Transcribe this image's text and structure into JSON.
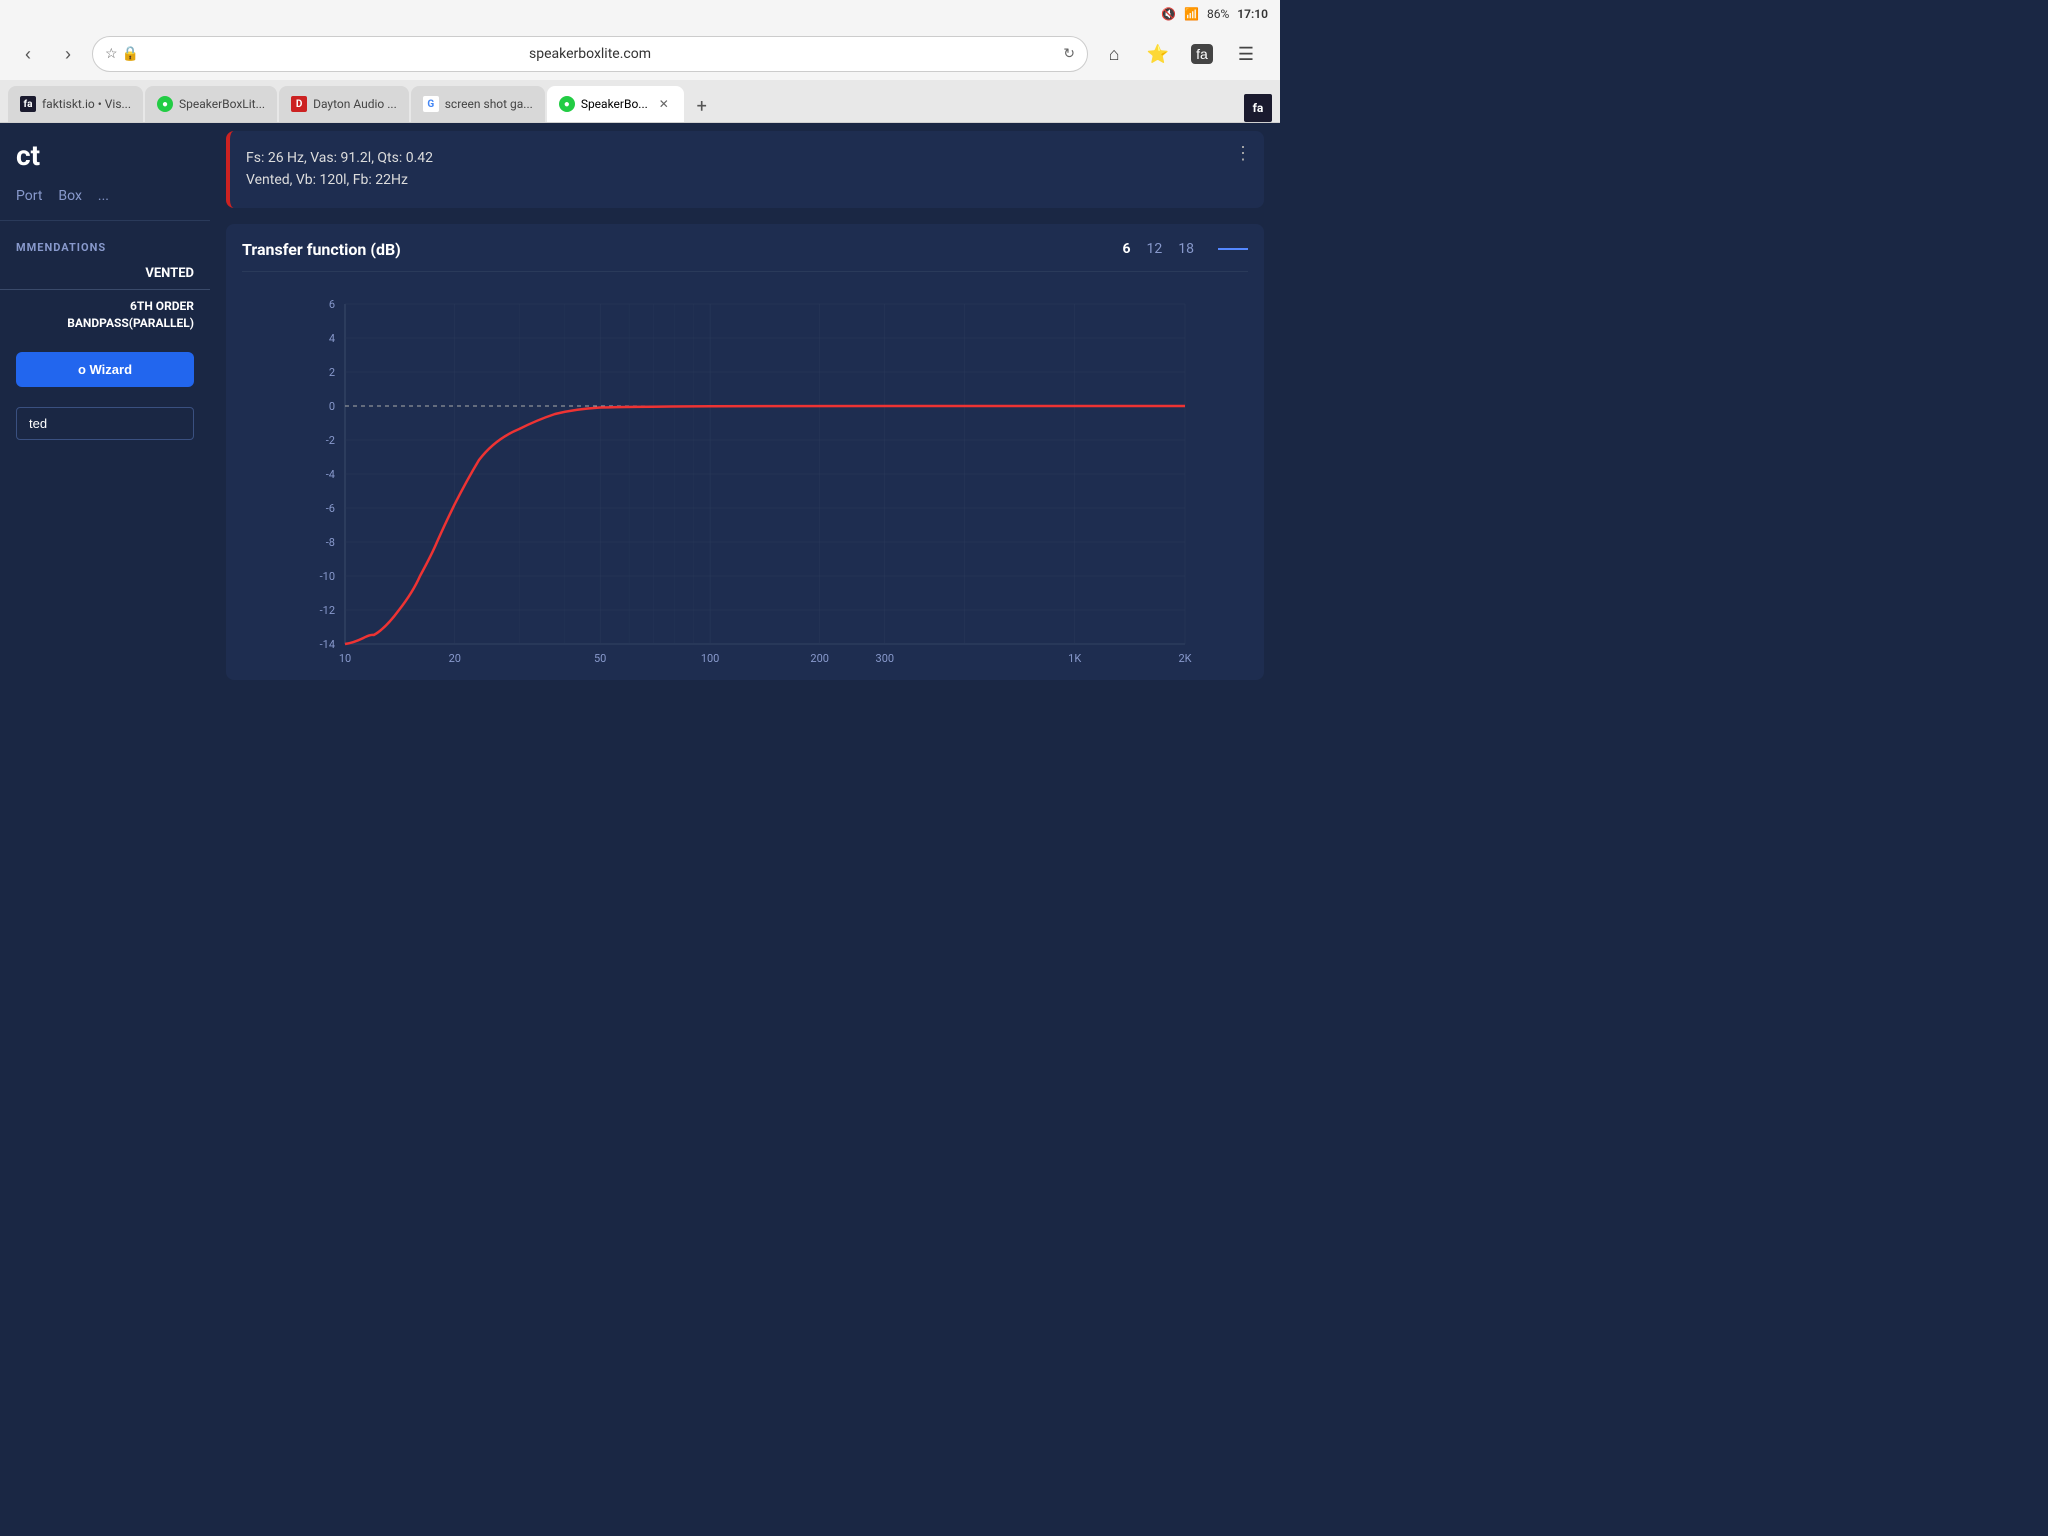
{
  "status_bar": {
    "battery": "86%",
    "time": "17:10"
  },
  "browser": {
    "back_label": "‹",
    "forward_label": "›",
    "url": "speakerboxlite.com",
    "tabs": [
      {
        "id": "tab1",
        "favicon_type": "fa",
        "favicon_text": "fa",
        "label": "faktiskt.io • Vis...",
        "active": false,
        "closeable": false
      },
      {
        "id": "tab2",
        "favicon_type": "spk",
        "favicon_text": "●",
        "label": "SpeakerBoxLit...",
        "active": false,
        "closeable": false
      },
      {
        "id": "tab3",
        "favicon_type": "dayton",
        "favicon_text": "D",
        "label": "Dayton Audio ...",
        "active": false,
        "closeable": false
      },
      {
        "id": "tab4",
        "favicon_type": "google",
        "favicon_text": "G",
        "label": "screen shot ga...",
        "active": false,
        "closeable": false
      },
      {
        "id": "tab5",
        "favicon_type": "spk",
        "favicon_text": "●",
        "label": "SpeakerBo...",
        "active": true,
        "closeable": true
      }
    ],
    "new_tab_label": "+"
  },
  "sidebar": {
    "title_partial": "ct",
    "tabs": [
      {
        "label": "Port",
        "active": false
      },
      {
        "label": "Box",
        "active": false
      },
      {
        "label": "...",
        "active": false
      }
    ],
    "section_title": "MMENDATIONS",
    "vented_label": "VENTED",
    "bandpass_label": "6TH ORDER\nBANDPASS(PARALLEL)",
    "wizard_btn_label": "o Wizard",
    "input_placeholder": "ted"
  },
  "info_card": {
    "line1": "Fs: 26 Hz, Vas: 91.2l, Qts: 0.42",
    "line2": "Vented, Vb: 120l, Fb: 22Hz"
  },
  "chart": {
    "title": "Transfer function (dB)",
    "range_options": [
      "6",
      "12",
      "18"
    ],
    "active_range": "6",
    "y_labels": [
      "6",
      "4",
      "2",
      "0",
      "-2",
      "-4",
      "-6",
      "-8",
      "-10",
      "-12",
      "-14"
    ],
    "x_labels": [
      "10",
      "20",
      "50",
      "100",
      "200",
      "300",
      "1K",
      "2K"
    ]
  }
}
